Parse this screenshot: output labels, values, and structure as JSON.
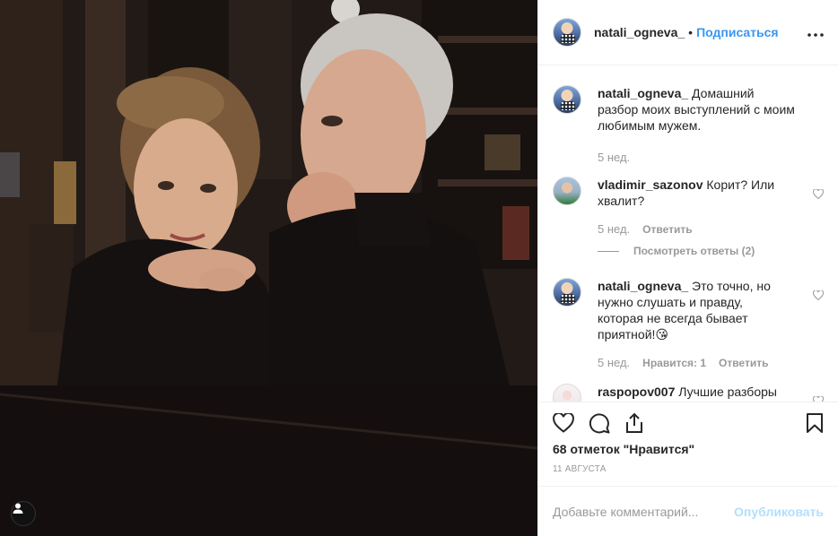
{
  "post": {
    "username": "natali_ogneva_",
    "separator": "•",
    "follow_label": "Подписаться",
    "more_icon": "ellipsis-icon"
  },
  "comments": [
    {
      "username": "natali_ogneva_",
      "text": "Домашний разбор моих выступлений с моим любимым мужем.",
      "time": "5 нед."
    },
    {
      "username": "vladimir_sazonov",
      "text": "Корит? Или хвалит?",
      "time": "5 нед.",
      "reply_label": "Ответить",
      "view_replies": "Посмотреть ответы (2)"
    },
    {
      "username": "natali_ogneva_",
      "text": "Это точно, но нужно слушать и правду, которая не всегда бывает приятной!😘",
      "time": "5 нед.",
      "likes_label": "Нравится: 1",
      "reply_label": "Ответить"
    },
    {
      "username": "raspopov007",
      "text": "Лучшие разборы"
    }
  ],
  "footer": {
    "likes": "68 отметок \"Нравится\"",
    "date": "11 августа",
    "comment_placeholder": "Добавьте комментарий...",
    "publish_label": "Опубликовать"
  },
  "colors": {
    "accent": "#3897f0",
    "publish_disabled": "#b2dffc",
    "muted": "#999999",
    "text": "#262626"
  }
}
